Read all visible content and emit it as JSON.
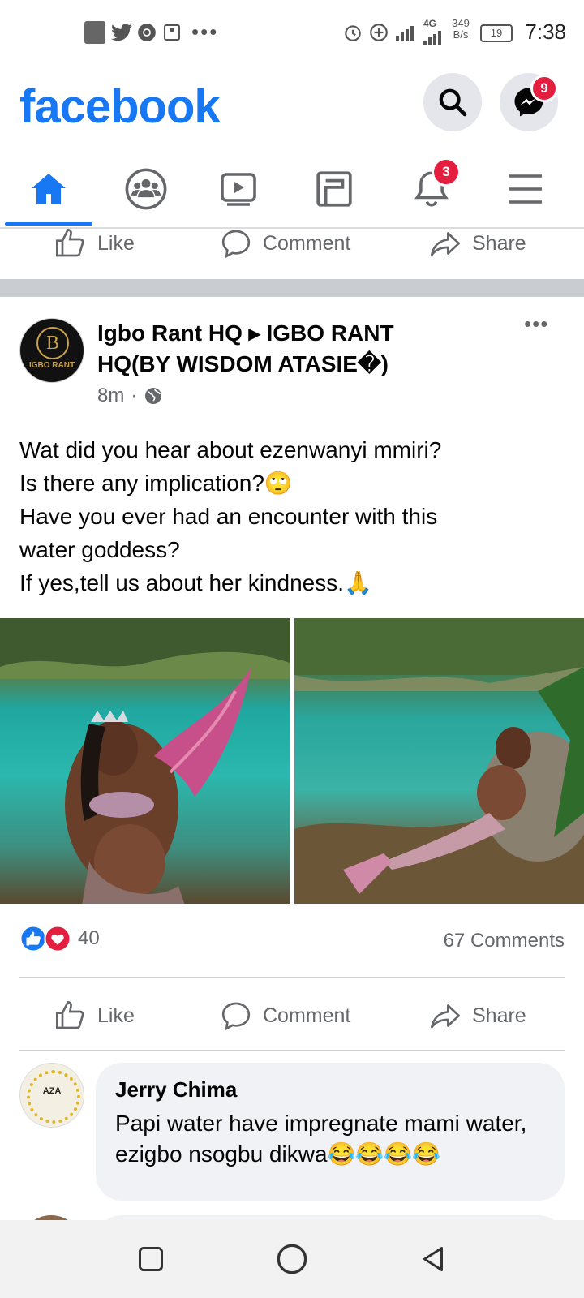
{
  "status_bar": {
    "time": "7:38",
    "net_speed_value": "349",
    "net_speed_unit": "B/s",
    "network_type": "4G",
    "battery": "19",
    "more": "•••"
  },
  "header": {
    "logo": "facebook",
    "messenger_badge": "9"
  },
  "nav": {
    "tabs": [
      "home-icon",
      "groups-icon",
      "watch-icon",
      "pages-icon",
      "notifications-icon",
      "menu-icon"
    ],
    "notifications_badge": "3"
  },
  "actions": {
    "like": "Like",
    "comment": "Comment",
    "share": "Share"
  },
  "post": {
    "author_line1": "Igbo Rant HQ ▸ IGBO RANT",
    "author_line2": "HQ(BY WISDOM ATASIE�)",
    "time": "8m",
    "more": "•••",
    "avatar_text": "IGBO RANT",
    "text_lines": [
      "Wat did you hear about ezenwanyi mmiri?",
      "Is there any implication?🙄",
      "Have you ever had an encounter with this",
      "water goddess?",
      "If yes,tell us about her kindness.🙏"
    ],
    "reactions_count": "40",
    "comments_count": "67 Comments"
  },
  "comment": {
    "name": "Jerry Chima",
    "text": "Papi water have impregnate mami water,  ezigbo nsogbu dikwa😂😂😂😂",
    "avatar_text": "AZA"
  },
  "colors": {
    "brand": "#1877F2",
    "badge": "#E41E3F",
    "muted": "#65676B"
  }
}
